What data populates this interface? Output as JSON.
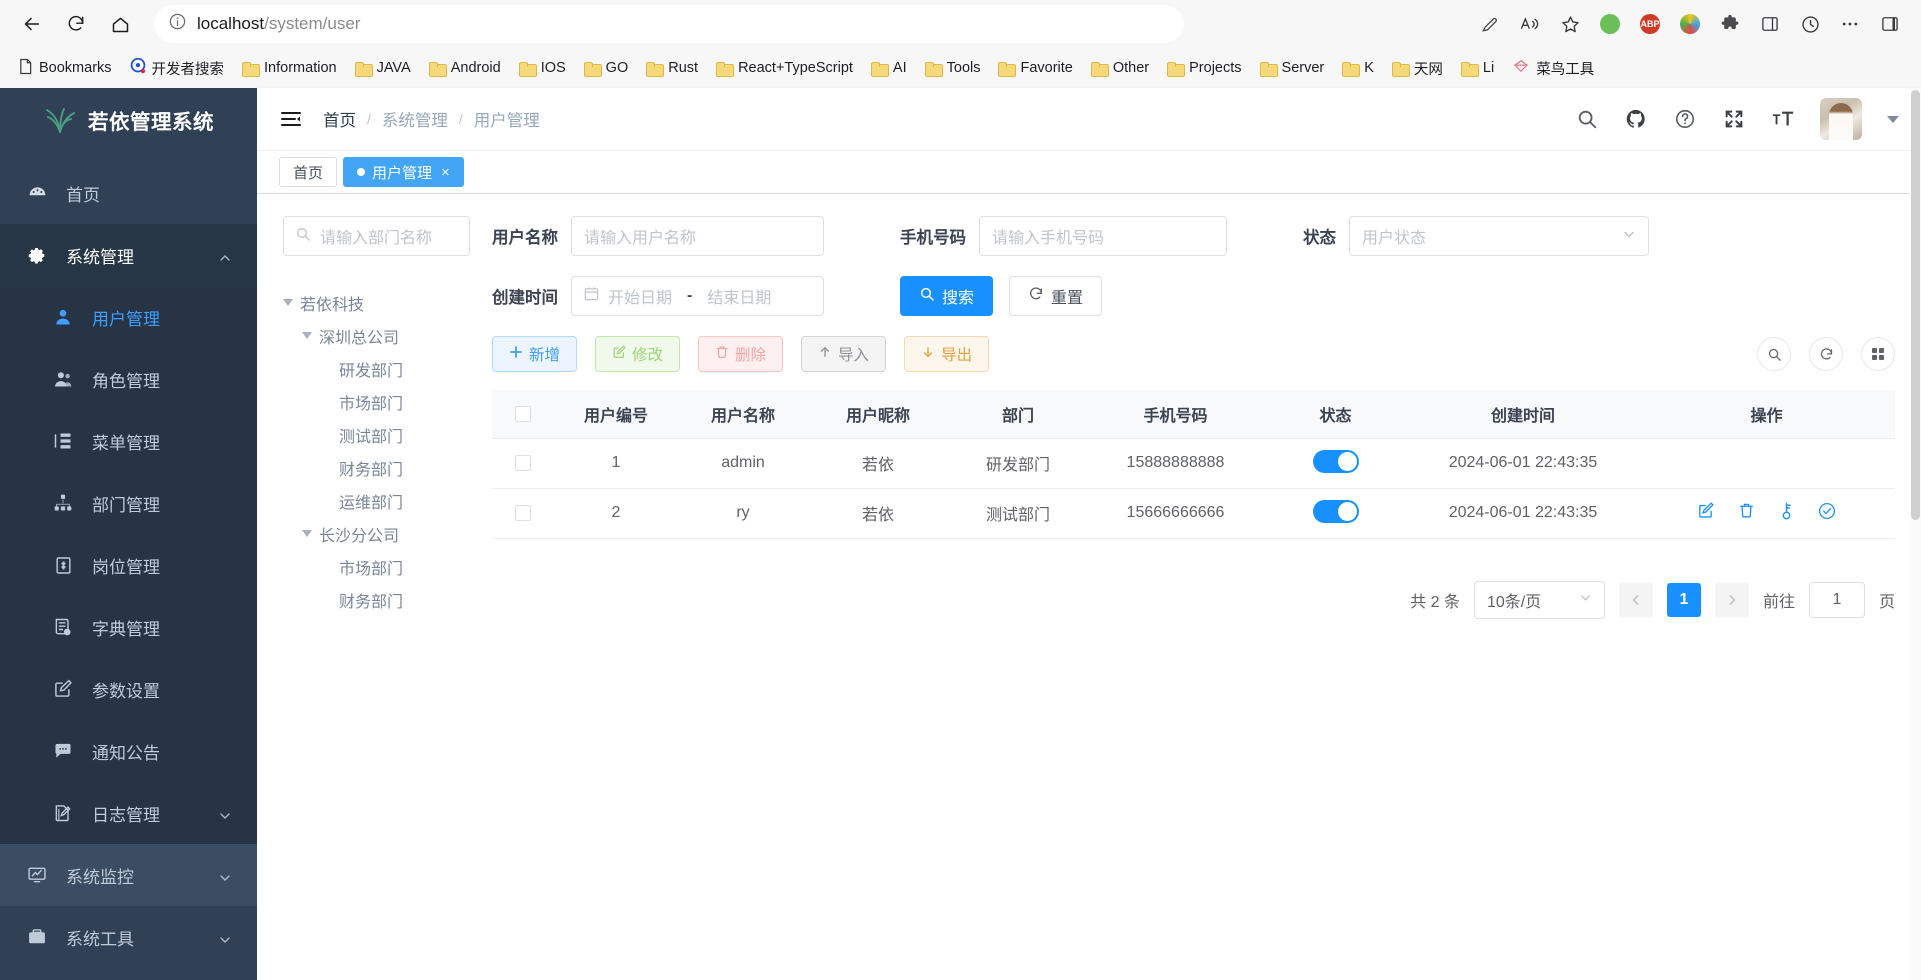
{
  "browser": {
    "url_main": "localhost",
    "url_path": "/system/user",
    "back_icon": "back-arrow-icon",
    "reload_icon": "reload-icon",
    "home_icon": "home-icon",
    "info_icon": "info-circle-icon",
    "bookmarks": [
      {
        "label": "Bookmarks",
        "icon": "page-icon"
      },
      {
        "label": "开发者搜索",
        "icon": "dev-search-icon"
      },
      {
        "label": "Information",
        "icon": "folder-icon"
      },
      {
        "label": "JAVA",
        "icon": "folder-icon"
      },
      {
        "label": "Android",
        "icon": "folder-icon"
      },
      {
        "label": "IOS",
        "icon": "folder-icon"
      },
      {
        "label": "GO",
        "icon": "folder-icon"
      },
      {
        "label": "Rust",
        "icon": "folder-icon"
      },
      {
        "label": "React+TypeScript",
        "icon": "folder-icon"
      },
      {
        "label": "AI",
        "icon": "folder-icon"
      },
      {
        "label": "Tools",
        "icon": "folder-icon"
      },
      {
        "label": "Favorite",
        "icon": "folder-icon"
      },
      {
        "label": "Other",
        "icon": "folder-icon"
      },
      {
        "label": "Projects",
        "icon": "folder-icon"
      },
      {
        "label": "Server",
        "icon": "folder-icon"
      },
      {
        "label": "K",
        "icon": "folder-icon"
      },
      {
        "label": "天网",
        "icon": "folder-icon"
      },
      {
        "label": "Li",
        "icon": "folder-icon"
      },
      {
        "label": "菜鸟工具",
        "icon": "runoob-icon"
      }
    ]
  },
  "sidebar": {
    "brand": "若依管理系统",
    "logo_icon": "leaf-logo-icon",
    "items": [
      {
        "label": "首页",
        "icon": "dashboard-icon",
        "level": 1
      },
      {
        "label": "系统管理",
        "icon": "gear-icon",
        "level": 1,
        "expanded": true,
        "chevron": "chevron-up-icon"
      },
      {
        "label": "用户管理",
        "icon": "user-icon",
        "level": 2,
        "active": true
      },
      {
        "label": "角色管理",
        "icon": "users-icon",
        "level": 2
      },
      {
        "label": "菜单管理",
        "icon": "menu-tree-icon",
        "level": 2
      },
      {
        "label": "部门管理",
        "icon": "sitemap-icon",
        "level": 2
      },
      {
        "label": "岗位管理",
        "icon": "badge-icon",
        "level": 2
      },
      {
        "label": "字典管理",
        "icon": "book-icon",
        "level": 2
      },
      {
        "label": "参数设置",
        "icon": "edit-square-icon",
        "level": 2
      },
      {
        "label": "通知公告",
        "icon": "comment-icon",
        "level": 2
      },
      {
        "label": "日志管理",
        "icon": "log-edit-icon",
        "level": 2,
        "chevron": "chevron-down-icon"
      },
      {
        "label": "系统监控",
        "icon": "monitor-icon",
        "level": 1,
        "chevron": "chevron-down-icon"
      },
      {
        "label": "系统工具",
        "icon": "briefcase-icon",
        "level": 1,
        "chevron": "chevron-down-icon"
      }
    ]
  },
  "navbar": {
    "hamburger_icon": "hamburger-fold-icon",
    "breadcrumb": {
      "home": "首页",
      "separator": "/",
      "items": [
        "系统管理",
        "用户管理"
      ]
    },
    "icons": [
      "search-icon",
      "github-icon",
      "help-circle-icon",
      "fullscreen-icon",
      "font-size-icon"
    ],
    "avatar_icon": "avatar",
    "caret_icon": "caret-down-icon"
  },
  "tabs": [
    {
      "label": "首页",
      "active": false
    },
    {
      "label": "用户管理",
      "active": true,
      "closable": true,
      "close_label": "×"
    }
  ],
  "dept_panel": {
    "search_placeholder": "请输入部门名称",
    "search_icon": "search-icon",
    "tree": [
      {
        "label": "若依科技",
        "depth": 0,
        "expandable": true
      },
      {
        "label": "深圳总公司",
        "depth": 1,
        "expandable": true
      },
      {
        "label": "研发部门",
        "depth": 2,
        "expandable": false
      },
      {
        "label": "市场部门",
        "depth": 2,
        "expandable": false
      },
      {
        "label": "测试部门",
        "depth": 2,
        "expandable": false
      },
      {
        "label": "财务部门",
        "depth": 2,
        "expandable": false
      },
      {
        "label": "运维部门",
        "depth": 2,
        "expandable": false
      },
      {
        "label": "长沙分公司",
        "depth": 1,
        "expandable": true
      },
      {
        "label": "市场部门",
        "depth": 2,
        "expandable": false
      },
      {
        "label": "财务部门",
        "depth": 2,
        "expandable": false
      }
    ]
  },
  "search_form": {
    "user_name_label": "用户名称",
    "user_name_placeholder": "请输入用户名称",
    "phone_label": "手机号码",
    "phone_placeholder": "请输入手机号码",
    "status_label": "状态",
    "status_placeholder": "用户状态",
    "status_chevron": "chevron-down-icon",
    "created_label": "创建时间",
    "date_start_placeholder": "开始日期",
    "date_end_placeholder": "结束日期",
    "date_separator": "-",
    "date_icon": "calendar-icon",
    "search_button": "搜索",
    "search_button_icon": "search-icon",
    "reset_button": "重置",
    "reset_button_icon": "refresh-icon"
  },
  "toolbar": {
    "buttons": [
      {
        "label": "新增",
        "icon": "plus-icon",
        "style": "bs-add"
      },
      {
        "label": "修改",
        "icon": "edit-icon",
        "style": "bs-edit"
      },
      {
        "label": "删除",
        "icon": "trash-icon",
        "style": "bs-del"
      },
      {
        "label": "导入",
        "icon": "upload-icon",
        "style": "bs-imp"
      },
      {
        "label": "导出",
        "icon": "download-icon",
        "style": "bs-exp"
      }
    ],
    "round_icons": [
      "search-toggle-icon",
      "refresh-icon",
      "columns-icon"
    ]
  },
  "table": {
    "columns": [
      "",
      "用户编号",
      "用户名称",
      "用户昵称",
      "部门",
      "手机号码",
      "状态",
      "创建时间",
      "操作"
    ],
    "rows": [
      {
        "id": "1",
        "user_name": "admin",
        "nick_name": "若依",
        "dept": "研发部门",
        "phone": "15888888888",
        "status_on": true,
        "created_at": "2024-06-01 22:43:35",
        "ops": []
      },
      {
        "id": "2",
        "user_name": "ry",
        "nick_name": "若依",
        "dept": "测试部门",
        "phone": "15666666666",
        "status_on": true,
        "created_at": "2024-06-01 22:43:35",
        "ops": [
          "edit-icon",
          "trash-icon",
          "key-icon",
          "check-circle-icon"
        ]
      }
    ]
  },
  "pagination": {
    "total_text": "共 2 条",
    "page_size": "10条/页",
    "page_size_chevron": "chevron-down-icon",
    "prev_icon": "chevron-left-icon",
    "next_icon": "chevron-right-icon",
    "current_page": "1",
    "jump_label": "前往",
    "jump_value": "1",
    "jump_suffix": "页"
  },
  "colors": {
    "sidebar_bg": "#304156",
    "sidebar_sub_bg": "#263445",
    "accent": "#1890ff",
    "tab_active": "#42a5f5",
    "active_text": "#409eff"
  }
}
